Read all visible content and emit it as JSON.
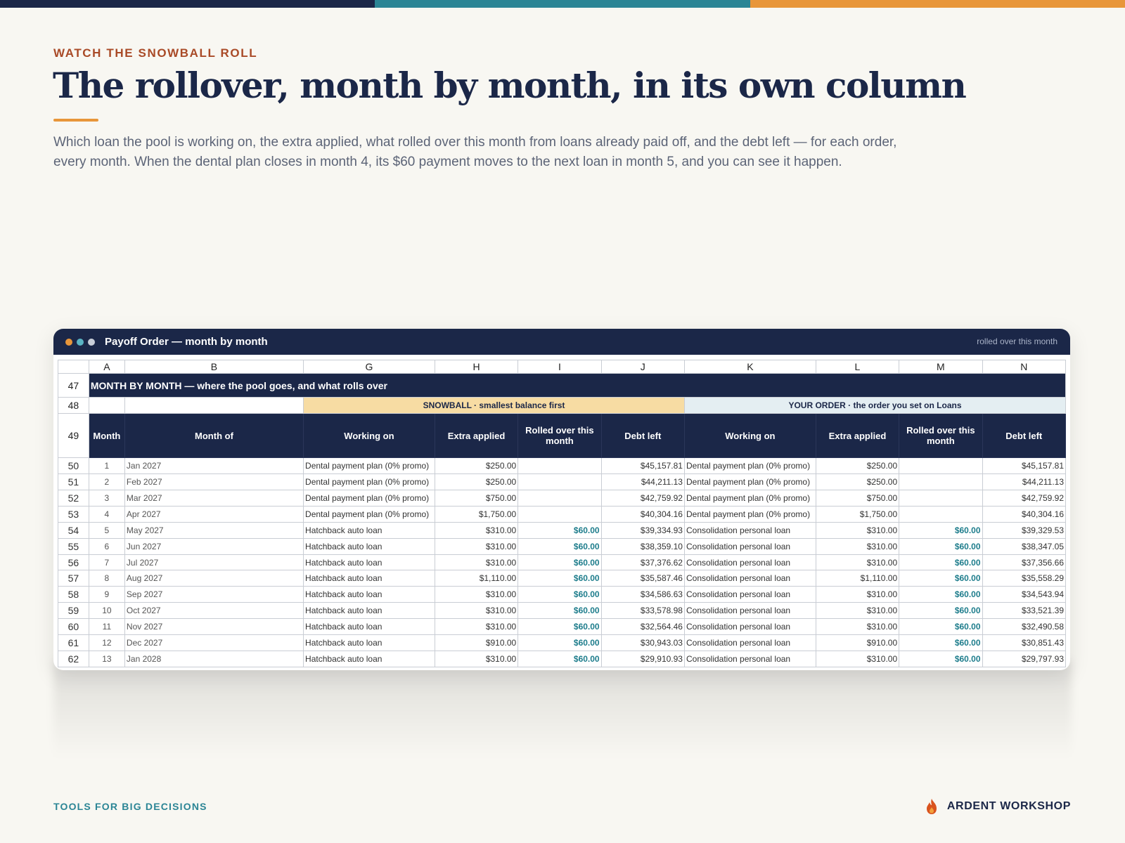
{
  "colors": {
    "navy": "#1b2748",
    "teal": "#2b8595",
    "orange": "#e8963a",
    "rust": "#a94a27",
    "snowball_band": "#f7dca3",
    "order_band": "#e4eef2"
  },
  "header": {
    "eyebrow": "WATCH THE SNOWBALL ROLL",
    "title": "The rollover, month by month, in its own column",
    "lede": "Which loan the pool is working on, the extra applied, what rolled over this month from loans already paid off, and the debt left — for each order, every month. When the dental plan closes in month 4, its $60 payment moves to the next loan in month 5, and you can see it happen."
  },
  "window": {
    "title": "Payoff Order — month by month",
    "right_label": "rolled over this month",
    "dots": [
      "#e8963a",
      "#5bb4c4",
      "#c9ced8"
    ]
  },
  "sheet": {
    "columns": [
      "A",
      "B",
      "G",
      "H",
      "I",
      "J",
      "K",
      "L",
      "M",
      "N"
    ],
    "banner": {
      "row": "47",
      "text": "MONTH BY MONTH  —  where the pool goes, and what rolls over"
    },
    "section_row": "48",
    "snowball_label": "SNOWBALL  ·  smallest balance first",
    "order_label": "YOUR ORDER  ·  the order you set on Loans",
    "header_row": "49",
    "headers": [
      "Month",
      "Month of",
      "Working on",
      "Extra applied",
      "Rolled over this month",
      "Debt left",
      "Working on",
      "Extra applied",
      "Rolled over this month",
      "Debt left"
    ],
    "rows": [
      {
        "r": "50",
        "m": "1",
        "of": "Jan 2027",
        "sw": "Dental payment plan (0% promo)",
        "se": "$250.00",
        "sr": "",
        "sd": "$45,157.81",
        "ow": "Dental payment plan (0% promo)",
        "oe": "$250.00",
        "or": "",
        "od": "$45,157.81"
      },
      {
        "r": "51",
        "m": "2",
        "of": "Feb 2027",
        "sw": "Dental payment plan (0% promo)",
        "se": "$250.00",
        "sr": "",
        "sd": "$44,211.13",
        "ow": "Dental payment plan (0% promo)",
        "oe": "$250.00",
        "or": "",
        "od": "$44,211.13"
      },
      {
        "r": "52",
        "m": "3",
        "of": "Mar 2027",
        "sw": "Dental payment plan (0% promo)",
        "se": "$750.00",
        "sr": "",
        "sd": "$42,759.92",
        "ow": "Dental payment plan (0% promo)",
        "oe": "$750.00",
        "or": "",
        "od": "$42,759.92"
      },
      {
        "r": "53",
        "m": "4",
        "of": "Apr 2027",
        "sw": "Dental payment plan (0% promo)",
        "se": "$1,750.00",
        "sr": "",
        "sd": "$40,304.16",
        "ow": "Dental payment plan (0% promo)",
        "oe": "$1,750.00",
        "or": "",
        "od": "$40,304.16"
      },
      {
        "r": "54",
        "m": "5",
        "of": "May 2027",
        "sw": "Hatchback auto loan",
        "se": "$310.00",
        "sr": "$60.00",
        "sd": "$39,334.93",
        "ow": "Consolidation personal loan",
        "oe": "$310.00",
        "or": "$60.00",
        "od": "$39,329.53"
      },
      {
        "r": "55",
        "m": "6",
        "of": "Jun 2027",
        "sw": "Hatchback auto loan",
        "se": "$310.00",
        "sr": "$60.00",
        "sd": "$38,359.10",
        "ow": "Consolidation personal loan",
        "oe": "$310.00",
        "or": "$60.00",
        "od": "$38,347.05"
      },
      {
        "r": "56",
        "m": "7",
        "of": "Jul 2027",
        "sw": "Hatchback auto loan",
        "se": "$310.00",
        "sr": "$60.00",
        "sd": "$37,376.62",
        "ow": "Consolidation personal loan",
        "oe": "$310.00",
        "or": "$60.00",
        "od": "$37,356.66"
      },
      {
        "r": "57",
        "m": "8",
        "of": "Aug 2027",
        "sw": "Hatchback auto loan",
        "se": "$1,110.00",
        "sr": "$60.00",
        "sd": "$35,587.46",
        "ow": "Consolidation personal loan",
        "oe": "$1,110.00",
        "or": "$60.00",
        "od": "$35,558.29"
      },
      {
        "r": "58",
        "m": "9",
        "of": "Sep 2027",
        "sw": "Hatchback auto loan",
        "se": "$310.00",
        "sr": "$60.00",
        "sd": "$34,586.63",
        "ow": "Consolidation personal loan",
        "oe": "$310.00",
        "or": "$60.00",
        "od": "$34,543.94"
      },
      {
        "r": "59",
        "m": "10",
        "of": "Oct 2027",
        "sw": "Hatchback auto loan",
        "se": "$310.00",
        "sr": "$60.00",
        "sd": "$33,578.98",
        "ow": "Consolidation personal loan",
        "oe": "$310.00",
        "or": "$60.00",
        "od": "$33,521.39"
      },
      {
        "r": "60",
        "m": "11",
        "of": "Nov 2027",
        "sw": "Hatchback auto loan",
        "se": "$310.00",
        "sr": "$60.00",
        "sd": "$32,564.46",
        "ow": "Consolidation personal loan",
        "oe": "$310.00",
        "or": "$60.00",
        "od": "$32,490.58"
      },
      {
        "r": "61",
        "m": "12",
        "of": "Dec 2027",
        "sw": "Hatchback auto loan",
        "se": "$910.00",
        "sr": "$60.00",
        "sd": "$30,943.03",
        "ow": "Consolidation personal loan",
        "oe": "$910.00",
        "or": "$60.00",
        "od": "$30,851.43"
      },
      {
        "r": "62",
        "m": "13",
        "of": "Jan 2028",
        "sw": "Hatchback auto loan",
        "se": "$310.00",
        "sr": "$60.00",
        "sd": "$29,910.93",
        "ow": "Consolidation personal loan",
        "oe": "$310.00",
        "or": "$60.00",
        "od": "$29,797.93"
      }
    ]
  },
  "footer": {
    "left": "TOOLS FOR BIG DECISIONS",
    "brand": "ARDENT WORKSHOP",
    "brand_icon": "flame-icon"
  }
}
